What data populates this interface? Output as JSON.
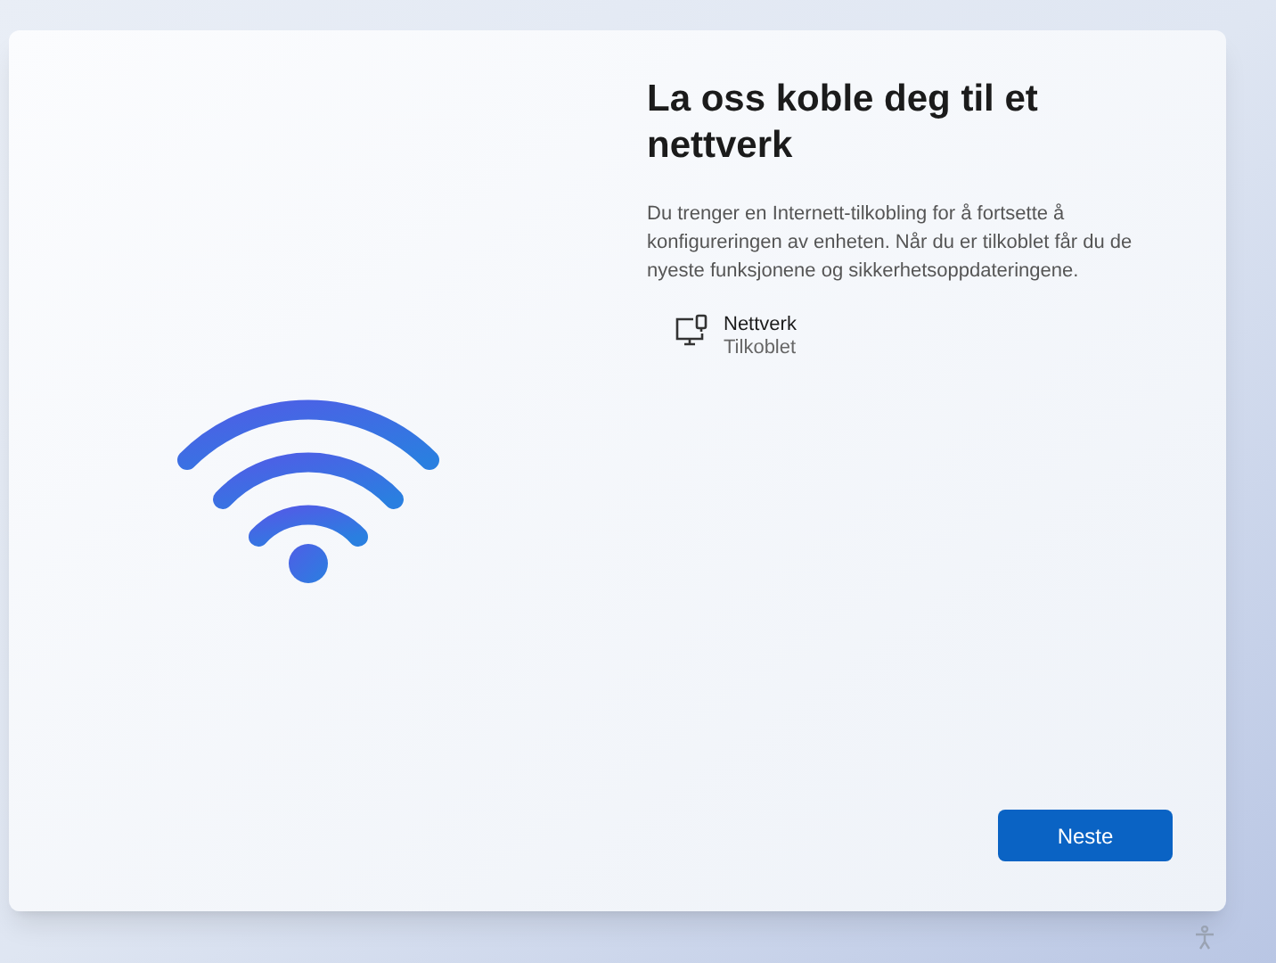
{
  "title": "La oss koble deg til et nettverk",
  "description": "Du trenger en Internett-tilkobling for å fortsette å konfigureringen av enheten. Når du er tilkoblet får du de nyeste funksjonene og sikkerhetsoppdateringene.",
  "networks": [
    {
      "kind": "wired",
      "name": "Nettverk",
      "status": "Tilkoblet"
    }
  ],
  "buttons": [
    {
      "label": "Neste"
    }
  ]
}
